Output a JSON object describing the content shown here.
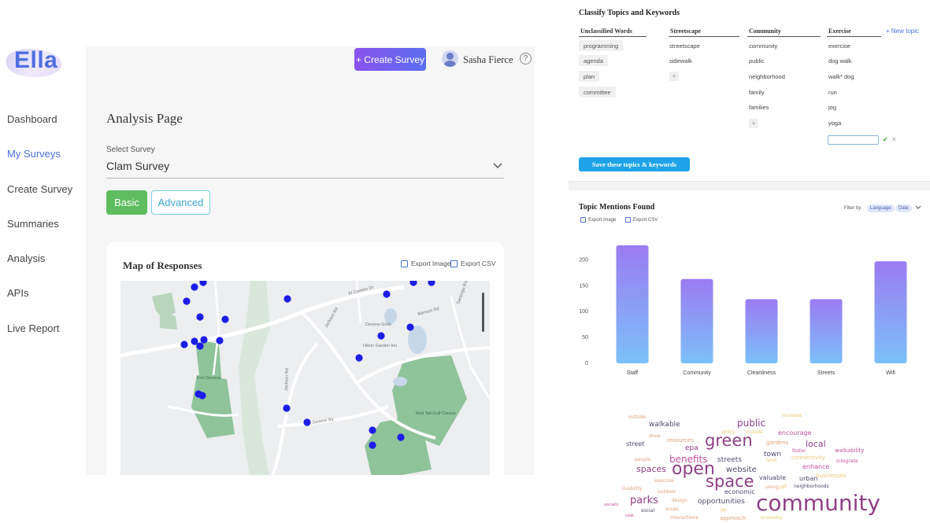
{
  "app": {
    "logo_text": "Ella",
    "nav": [
      {
        "label": "Dashboard",
        "active": false
      },
      {
        "label": "My Surveys",
        "active": true
      },
      {
        "label": "Create Survey",
        "active": false
      },
      {
        "label": "Summaries",
        "active": false
      },
      {
        "label": "Analysis",
        "active": false
      },
      {
        "label": "APIs",
        "active": false
      },
      {
        "label": "Live Report",
        "active": false
      }
    ],
    "header": {
      "create_button": "+ Create Survey",
      "user_name": "Sasha Fierce",
      "help_glyph": "?"
    },
    "page_title": "Analysis Page",
    "survey_select": {
      "label": "Select Survey",
      "value": "Clam Survey"
    },
    "mode_buttons": {
      "basic": "Basic",
      "advanced": "Advanced"
    },
    "map_card": {
      "title": "Map of Responses",
      "export_image": "Export Image",
      "export_csv": "Export CSV",
      "place_labels": [
        "El Camino Dr",
        "Jackson Rd",
        "Devens Grille",
        "Hilton Garden Inn",
        "Barnum Rd",
        "Fort Devens",
        "Jackson Rd",
        "Devens Sq",
        "Red Tail Golf Course",
        "Saratoga Blvd"
      ]
    },
    "accent_colors": {
      "primary": "#5b6ef0",
      "nav_active": "#4c6fde",
      "basic_button": "#5dbd5f",
      "map_marker": "#1d1de6",
      "save_button": "#1ea3e8"
    }
  },
  "classify": {
    "title": "Classify Topics and Keywords",
    "new_topic": "+ New topic",
    "save_button": "Save these topics & keywords",
    "columns": [
      {
        "header": "Unclassified Words",
        "words": [
          "programming",
          "agenda",
          "plan",
          "committee"
        ]
      },
      {
        "header": "Streetscape",
        "words": [
          "streetscape",
          "sidewalk"
        ]
      },
      {
        "header": "Community",
        "words": [
          "community",
          "public",
          "neighborhood",
          "family",
          "families"
        ]
      },
      {
        "header": "Exercise",
        "words": [
          "exercise",
          "dog walk",
          "walk* dog",
          "run",
          "jog",
          "yoga"
        ]
      }
    ],
    "add_glyph": "+",
    "confirm_glyph": "✔",
    "cancel_glyph": "✕"
  },
  "topic_mentions": {
    "title": "Topic Mentions Found",
    "export_image": "Export image",
    "export_csv": "Export CSV",
    "filter_label": "Filter by",
    "filters": [
      "Language",
      "Date"
    ]
  },
  "chart_data": {
    "type": "bar",
    "categories": [
      "Staff",
      "Community",
      "Cleanliness",
      "Streets",
      "Wifi"
    ],
    "values": [
      228,
      163,
      124,
      124,
      197
    ],
    "title": "Topic Mentions Found",
    "xlabel": "",
    "ylabel": "",
    "ylim": [
      0,
      240
    ],
    "yticks": [
      0,
      50,
      100,
      150,
      200
    ],
    "grid": false,
    "bar_gradient": [
      "#9b7bf2",
      "#7cc0f8"
    ]
  },
  "word_cloud": {
    "words": [
      {
        "text": "community",
        "weight": 28,
        "color": "#8e3f86"
      },
      {
        "text": "open",
        "weight": 22,
        "color": "#8e3f86"
      },
      {
        "text": "space",
        "weight": 21,
        "color": "#8e3f86"
      },
      {
        "text": "green",
        "weight": 21,
        "color": "#8e3f86"
      },
      {
        "text": "public",
        "weight": 12,
        "color": "#8e3f86"
      },
      {
        "text": "parks",
        "weight": 13,
        "color": "#8e3f86"
      },
      {
        "text": "benefits",
        "weight": 12,
        "color": "#c0539e"
      },
      {
        "text": "spaces",
        "weight": 11,
        "color": "#8e3f86"
      },
      {
        "text": "local",
        "weight": 11,
        "color": "#8e3f86"
      },
      {
        "text": "website",
        "weight": 10,
        "color": "#4d4d6d"
      },
      {
        "text": "walkable",
        "weight": 9,
        "color": "#4d4d6d"
      },
      {
        "text": "town",
        "weight": 9,
        "color": "#4d4d6d"
      },
      {
        "text": "streets",
        "weight": 9,
        "color": "#4d4d6d"
      },
      {
        "text": "opportunities",
        "weight": 9,
        "color": "#4d4d6d"
      },
      {
        "text": "epa",
        "weight": 9,
        "color": "#8e3f86"
      },
      {
        "text": "economic",
        "weight": 8,
        "color": "#4d4d6d"
      },
      {
        "text": "encourage",
        "weight": 8,
        "color": "#c0539e"
      },
      {
        "text": "enhance",
        "weight": 8,
        "color": "#c0539e"
      },
      {
        "text": "walkability",
        "weight": 7,
        "color": "#c0539e"
      },
      {
        "text": "street",
        "weight": 8,
        "color": "#4d4d6d"
      },
      {
        "text": "valuable",
        "weight": 8,
        "color": "#4d4d6d"
      },
      {
        "text": "urban",
        "weight": 8,
        "color": "#4d4d6d"
      },
      {
        "text": "resources",
        "weight": 7,
        "color": "#e0a080"
      },
      {
        "text": "gardens",
        "weight": 7,
        "color": "#e0a080"
      },
      {
        "text": "connectivity",
        "weight": 7,
        "color": "#e8c870"
      },
      {
        "text": "businesses",
        "weight": 7,
        "color": "#e8c870"
      },
      {
        "text": "neighborhoods",
        "weight": 6,
        "color": "#4d4d6d"
      },
      {
        "text": "integrate",
        "weight": 6,
        "color": "#c0539e"
      },
      {
        "text": "foster",
        "weight": 6,
        "color": "#c0539e"
      },
      {
        "text": "exercise",
        "weight": 6,
        "color": "#e0a080"
      },
      {
        "text": "outdoor",
        "weight": 6,
        "color": "#e0a080"
      },
      {
        "text": "livability",
        "weight": 6,
        "color": "#e0a080"
      },
      {
        "text": "design",
        "weight": 6,
        "color": "#e0a080"
      },
      {
        "text": "approach",
        "weight": 7,
        "color": "#e0a080"
      },
      {
        "text": "social",
        "weight": 6,
        "color": "#4d4d6d"
      },
      {
        "text": "areas",
        "weight": 6,
        "color": "#e0a080"
      },
      {
        "text": "interactions",
        "weight": 6,
        "color": "#e0a080"
      },
      {
        "text": "economy",
        "weight": 6,
        "color": "#e8c870"
      },
      {
        "text": "using",
        "weight": 6,
        "color": "#e0a080"
      },
      {
        "text": "land",
        "weight": 6,
        "color": "#e8c870"
      },
      {
        "text": "pdf",
        "weight": 6,
        "color": "#e8c870"
      },
      {
        "text": "include",
        "weight": 6,
        "color": "#e8c870"
      },
      {
        "text": "increase",
        "weight": 6,
        "color": "#e8c870"
      },
      {
        "text": "outside",
        "weight": 6,
        "color": "#e0a080"
      },
      {
        "text": "draw",
        "weight": 6,
        "color": "#e0a080"
      },
      {
        "text": "people",
        "weight": 6,
        "color": "#e0a080"
      },
      {
        "text": "policy",
        "weight": 6,
        "color": "#e8c870"
      },
      {
        "text": "use",
        "weight": 6,
        "color": "#c0539e"
      },
      {
        "text": "socially",
        "weight": 5,
        "color": "#c0539e"
      },
      {
        "text": "pp",
        "weight": 6,
        "color": "#e8c870"
      }
    ]
  }
}
